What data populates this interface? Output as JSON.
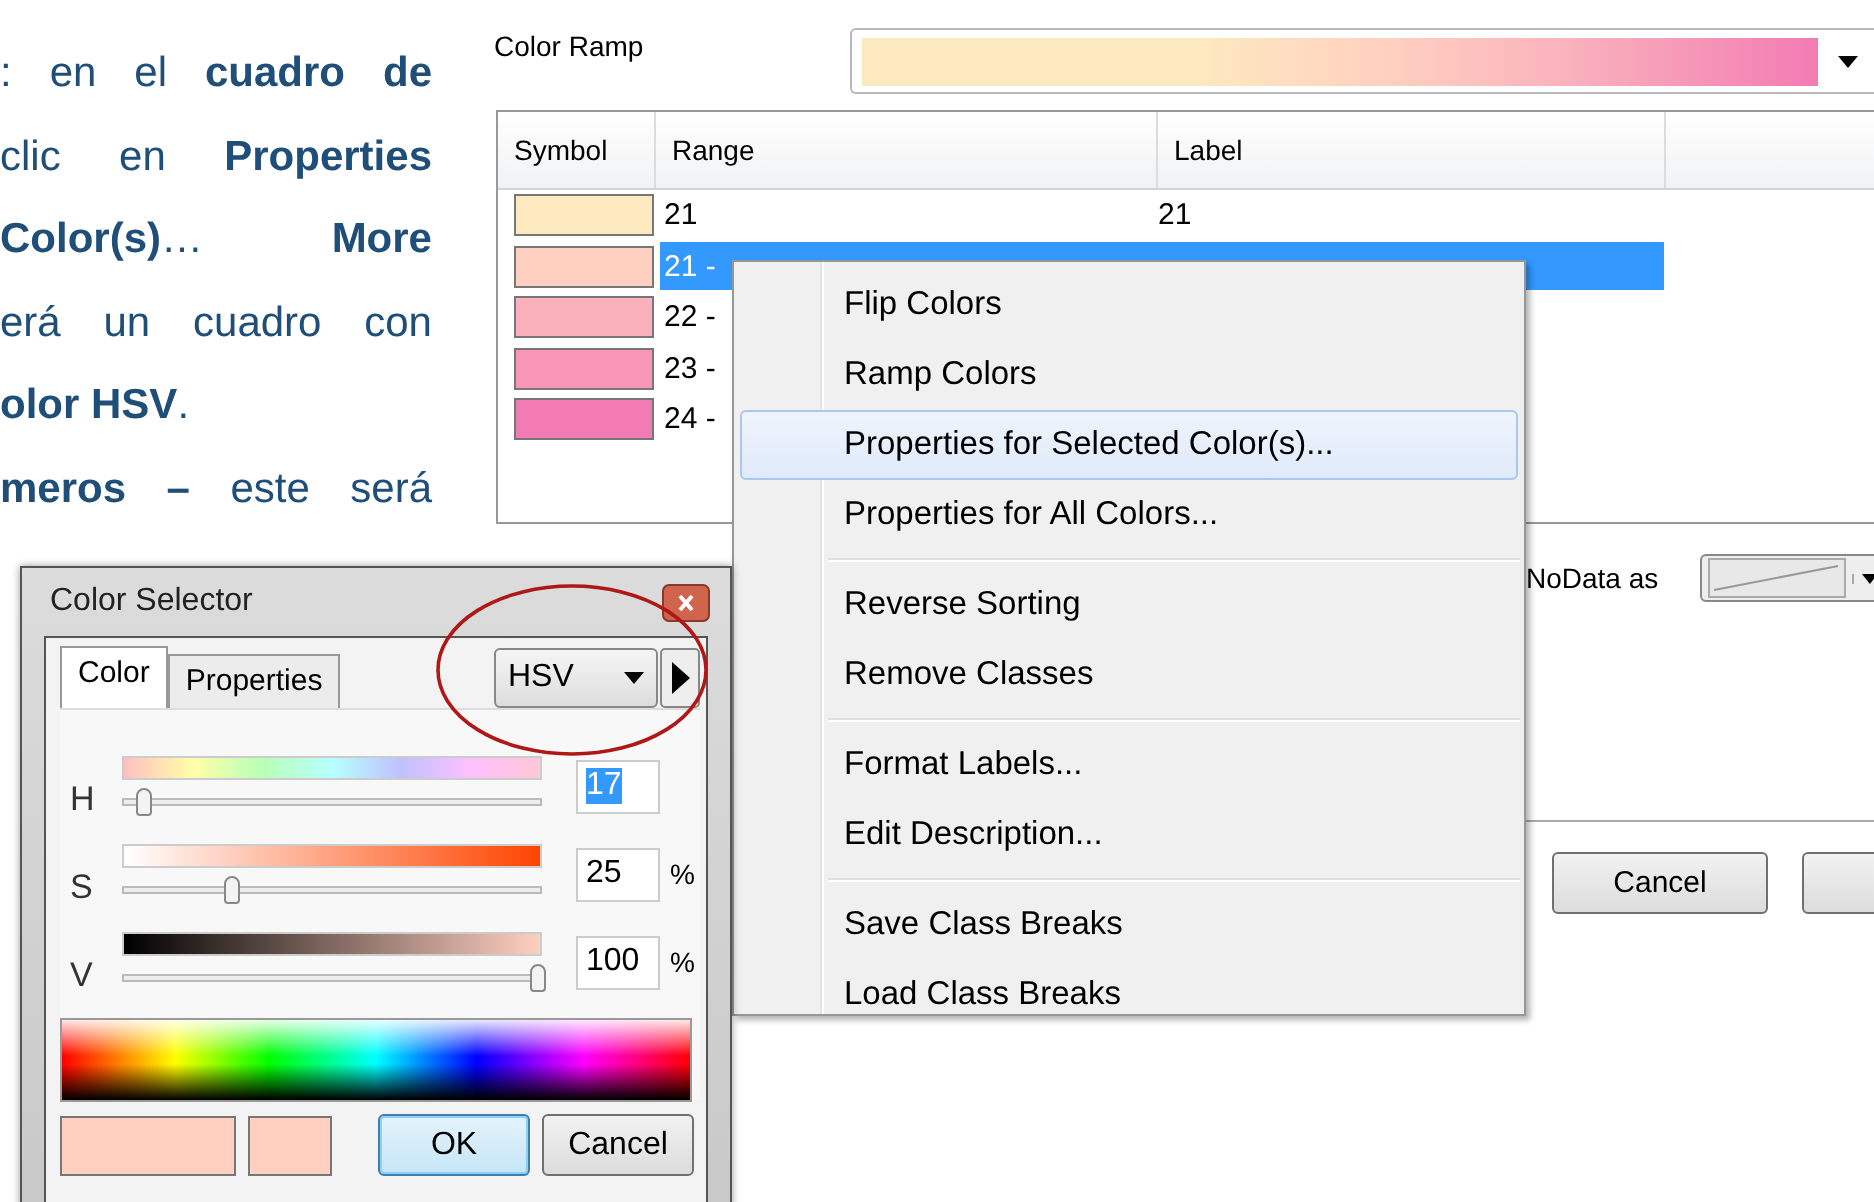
{
  "document": {
    "lines": [
      {
        "text": ": en el **cuadro de**",
        "paragraph_end": false
      },
      {
        "text": "clic en **Properties**",
        "paragraph_end": false
      },
      {
        "text": "**Color(s)**…   **More**",
        "paragraph_end": false
      },
      {
        "text": "erá un cuadro con",
        "paragraph_end": false
      },
      {
        "text": "**olor HSV**.",
        "paragraph_end": true
      },
      {
        "text": "**meros –** este será",
        "paragraph_end": false
      }
    ]
  },
  "symbology": {
    "color_ramp_label": "Color Ramp",
    "table": {
      "columns": [
        "Symbol",
        "Range",
        "Label"
      ],
      "rows": [
        {
          "color": "#fde9bf",
          "range": "21",
          "label": "21",
          "selected": false
        },
        {
          "color": "#ffd0c0",
          "range": "21 -",
          "selected": true
        },
        {
          "color": "#fbb1bb",
          "range": "22 -",
          "selected": false
        },
        {
          "color": "#f796b6",
          "range": "23 -",
          "selected": false
        },
        {
          "color": "#f37bb3",
          "range": "24 -",
          "selected": false
        }
      ]
    },
    "nodata_label": "NoData as",
    "cancel_button": "Cancel"
  },
  "context_menu": {
    "groups": [
      [
        {
          "label": "Flip Colors",
          "selected": false
        },
        {
          "label": "Ramp Colors",
          "selected": false
        },
        {
          "label": "Properties for Selected Color(s)...",
          "selected": true
        },
        {
          "label": "Properties for All Colors...",
          "selected": false
        }
      ],
      [
        {
          "label": "Reverse Sorting",
          "selected": false
        },
        {
          "label": "Remove Classes",
          "selected": false
        }
      ],
      [
        {
          "label": "Format Labels...",
          "selected": false
        },
        {
          "label": "Edit Description...",
          "selected": false
        }
      ],
      [
        {
          "label": "Save Class Breaks",
          "selected": false
        },
        {
          "label": "Load Class Breaks",
          "selected": false
        }
      ]
    ]
  },
  "color_selector": {
    "title": "Color Selector",
    "tabs": [
      {
        "label": "Color",
        "selected": true
      },
      {
        "label": "Properties",
        "selected": false
      }
    ],
    "mode": "HSV",
    "channels": [
      {
        "kind": "hue",
        "name": "H",
        "level": 0.05,
        "value": "17",
        "highlighted": true
      },
      {
        "kind": "saturation",
        "name": "S",
        "level": 0.26,
        "value": "25",
        "unit": "%",
        "highlighted": false
      },
      {
        "kind": "value",
        "name": "V",
        "level": 0.99,
        "value": "100",
        "unit": "%",
        "highlighted": false
      }
    ],
    "preview_swatches": [
      {
        "color": "#ffd0c0"
      },
      {
        "color": "#ffd0c0"
      }
    ],
    "buttons": [
      {
        "label": "OK",
        "default": true
      },
      {
        "label": "Cancel",
        "default": false
      }
    ]
  }
}
